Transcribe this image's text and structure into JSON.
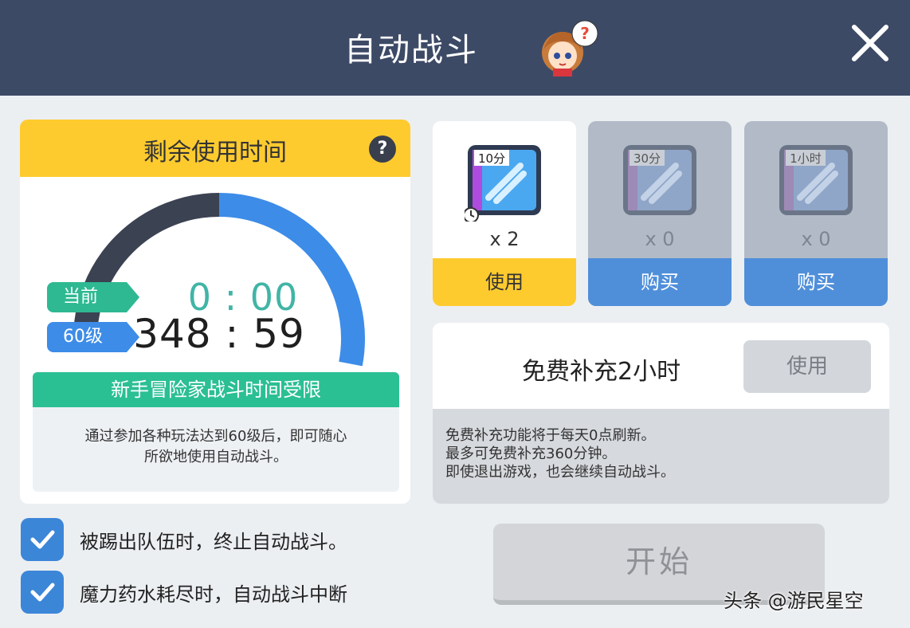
{
  "header": {
    "title": "自动战斗",
    "mascot_icon": "mascot-help-icon",
    "close_icon": "close-icon"
  },
  "time_panel": {
    "title": "剩余使用时间",
    "help_label": "?",
    "used_fraction": 0.25,
    "ring_colors": {
      "used": "#3b4252",
      "remaining": "#3d8ce8"
    },
    "current_tag": "当前",
    "current_time": "0 : 00",
    "level_tag": "60级",
    "limit_time": "348 : 59",
    "limit_banner": "新手冒险家战斗时间受限",
    "limit_desc_line1": "通过参加各种玩法达到60级后，即可随心",
    "limit_desc_line2": "所欲地使用自动战斗。"
  },
  "options": [
    {
      "label": "被踢出队伍时，终止自动战斗。",
      "checked": true
    },
    {
      "label": "魔力药水耗尽时，自动战斗中断",
      "checked": true
    }
  ],
  "items": [
    {
      "icon_label": "10分",
      "count": "x 2",
      "button": "使用",
      "state": "active"
    },
    {
      "icon_label": "30分",
      "count": "x 0",
      "button": "购买",
      "state": "inactive"
    },
    {
      "icon_label": "1小时",
      "count": "x 0",
      "button": "购买",
      "state": "inactive"
    }
  ],
  "free_refill": {
    "title": "免费补充2小时",
    "button": "使用",
    "desc_line1": "免费补充功能将于每天0点刷新。",
    "desc_line2": "最多可免费补充360分钟。",
    "desc_line3": "即使退出游戏，也会继续自动战斗。"
  },
  "start_button": "开始",
  "watermark": "头条 @游民星空",
  "colors": {
    "header": "#3d4a66",
    "yellow": "#fecb2f",
    "green": "#2bbf94",
    "blue": "#3d8ce8"
  }
}
